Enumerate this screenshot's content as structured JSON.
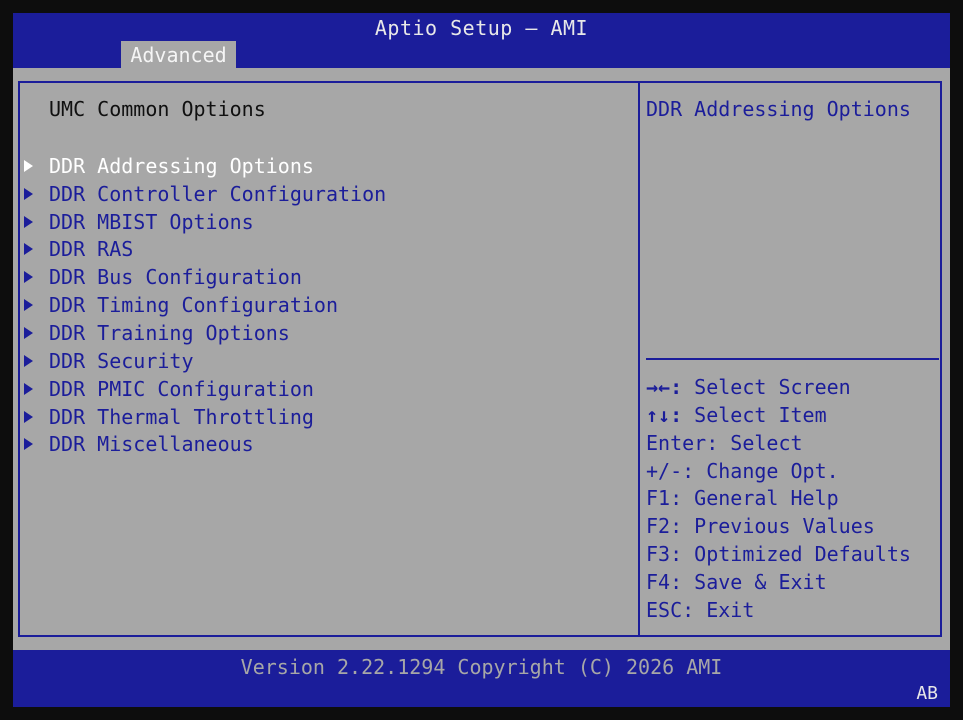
{
  "header": {
    "title": "Aptio Setup – AMI",
    "active_tab": "Advanced"
  },
  "main": {
    "section_title": "UMC Common Options",
    "selected_index": 0,
    "items": [
      {
        "label": "DDR Addressing Options"
      },
      {
        "label": "DDR Controller Configuration"
      },
      {
        "label": "DDR MBIST Options"
      },
      {
        "label": "DDR RAS"
      },
      {
        "label": "DDR Bus Configuration"
      },
      {
        "label": "DDR Timing Configuration"
      },
      {
        "label": "DDR Training Options"
      },
      {
        "label": "DDR Security"
      },
      {
        "label": "DDR PMIC Configuration"
      },
      {
        "label": "DDR Thermal Throttling"
      },
      {
        "label": "DDR Miscellaneous"
      }
    ]
  },
  "help_panel": {
    "description": "DDR Addressing Options",
    "keys": [
      {
        "key": "→←:",
        "action": "Select Screen"
      },
      {
        "key": "↑↓:",
        "action": "Select Item"
      },
      {
        "key": "Enter:",
        "action": "Select"
      },
      {
        "key": "+/-:",
        "action": "Change Opt."
      },
      {
        "key": "F1:",
        "action": "General Help"
      },
      {
        "key": "F2:",
        "action": "Previous Values"
      },
      {
        "key": "F3:",
        "action": "Optimized Defaults"
      },
      {
        "key": "F4:",
        "action": "Save & Exit"
      },
      {
        "key": "ESC:",
        "action": "Exit"
      }
    ]
  },
  "footer": {
    "version": "Version 2.22.1294 Copyright (C) 2026 AMI",
    "badge": "AB"
  },
  "colors": {
    "bios_blue": "#1b1d9a",
    "panel_gray": "#a7a7a7",
    "highlight_white": "#ffffff"
  }
}
